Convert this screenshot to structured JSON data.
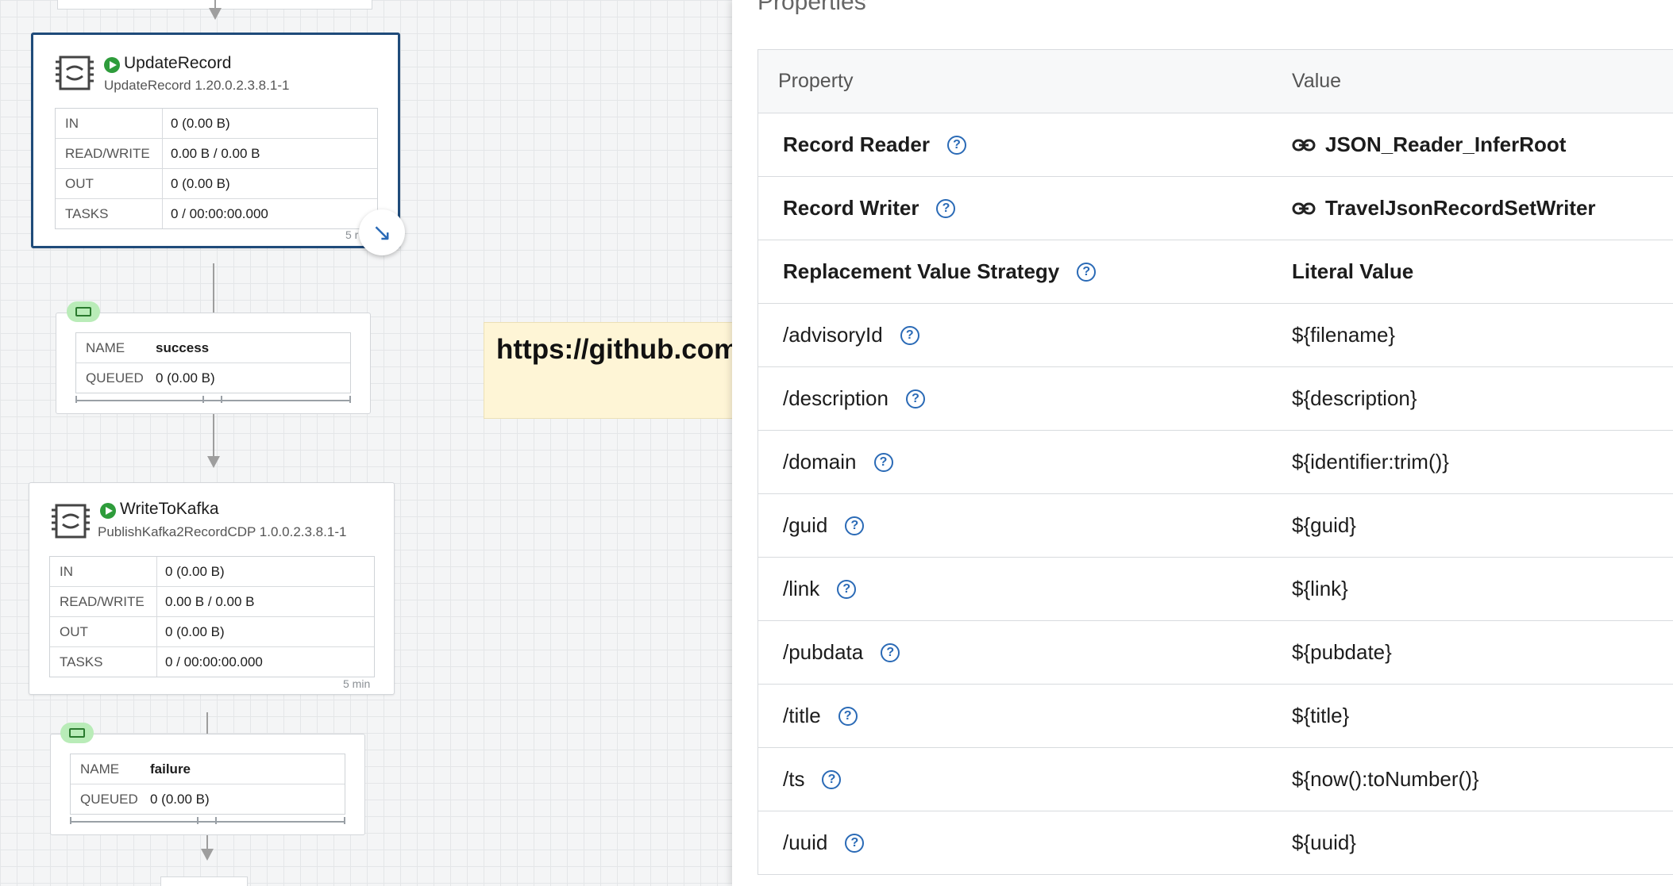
{
  "processors": [
    {
      "name": "UpdateRecord",
      "type": "UpdateRecord 1.20.0.2.3.8.1-1",
      "stats": [
        {
          "label": "IN",
          "value": "0 (0.00 B)"
        },
        {
          "label": "READ/WRITE",
          "value": "0.00 B / 0.00 B"
        },
        {
          "label": "OUT",
          "value": "0 (0.00 B)"
        },
        {
          "label": "TASKS",
          "value": "0 / 00:00:00.000"
        }
      ],
      "meta": "5 r"
    },
    {
      "name": "WriteToKafka",
      "type": "PublishKafka2RecordCDP 1.0.0.2.3.8.1-1",
      "stats": [
        {
          "label": "IN",
          "value": "0 (0.00 B)"
        },
        {
          "label": "READ/WRITE",
          "value": "0.00 B / 0.00 B"
        },
        {
          "label": "OUT",
          "value": "0 (0.00 B)"
        },
        {
          "label": "TASKS",
          "value": "0 / 00:00:00.000"
        }
      ],
      "meta": "5 min"
    }
  ],
  "connections": [
    {
      "name_label": "NAME",
      "name": "success",
      "queued_label": "QUEUED",
      "queued": "0 (0.00 B)"
    },
    {
      "name_label": "NAME",
      "name": "failure",
      "queued_label": "QUEUED",
      "queued": "0 (0.00 B)"
    }
  ],
  "note": {
    "text": "https://github.com"
  },
  "panel": {
    "title": "Properties",
    "header": {
      "property": "Property",
      "value": "Value"
    },
    "rows": [
      {
        "name": "Record Reader",
        "value": "JSON_Reader_InferRoot"
      },
      {
        "name": "Record Writer",
        "value": "TravelJsonRecordSetWriter"
      },
      {
        "name": "Replacement Value Strategy",
        "value": "Literal Value"
      },
      {
        "name": "/advisoryId",
        "value": "${filename}"
      },
      {
        "name": "/description",
        "value": "${description}"
      },
      {
        "name": "/domain",
        "value": "${identifier:trim()}"
      },
      {
        "name": "/guid",
        "value": "${guid}"
      },
      {
        "name": "/link",
        "value": "${link}"
      },
      {
        "name": "/pubdata",
        "value": "${pubdate}"
      },
      {
        "name": "/title",
        "value": "${title}"
      },
      {
        "name": "/ts",
        "value": "${now():toNumber()}"
      },
      {
        "name": "/uuid",
        "value": "${uuid}"
      }
    ]
  },
  "colors": {
    "accent": "#2a6ab6",
    "selected_border": "#1f4b7a",
    "running": "#2e9c3b",
    "note_bg": "#fef5d6",
    "queue_badge": "#b9ecb8"
  },
  "icons": [
    "processor-icon",
    "play-icon",
    "queue-icon",
    "link-icon",
    "help-icon",
    "arrow-icon"
  ]
}
